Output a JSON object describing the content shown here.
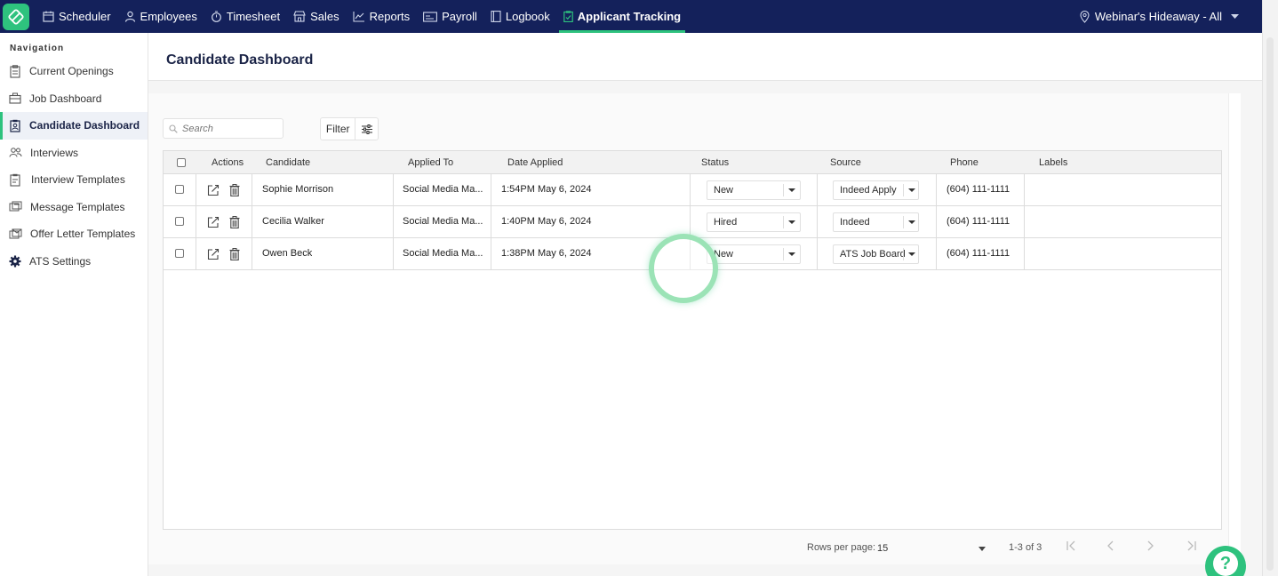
{
  "nav": {
    "items": [
      {
        "label": "Scheduler",
        "icon": "calendar-icon"
      },
      {
        "label": "Employees",
        "icon": "person-icon"
      },
      {
        "label": "Timesheet",
        "icon": "stopwatch-icon"
      },
      {
        "label": "Sales",
        "icon": "store-icon"
      },
      {
        "label": "Reports",
        "icon": "chart-line-icon"
      },
      {
        "label": "Payroll",
        "icon": "card-icon"
      },
      {
        "label": "Logbook",
        "icon": "book-icon"
      },
      {
        "label": "Applicant Tracking",
        "icon": "clipboard-icon"
      }
    ],
    "active": "Applicant Tracking",
    "location": "Webinar's Hideaway - All"
  },
  "sidebar": {
    "heading": "Navigation",
    "items": [
      {
        "label": "Current Openings",
        "icon": "clipboard-list-icon"
      },
      {
        "label": "Job Dashboard",
        "icon": "briefcase-icon"
      },
      {
        "label": "Candidate Dashboard",
        "icon": "id-badge-icon"
      },
      {
        "label": "Interviews",
        "icon": "people-icon"
      },
      {
        "label": "Interview Templates",
        "icon": "clipboard-template-icon"
      },
      {
        "label": "Message Templates",
        "icon": "message-icon"
      },
      {
        "label": "Offer Letter Templates",
        "icon": "letter-icon"
      },
      {
        "label": "ATS Settings",
        "icon": "gear-icon"
      }
    ],
    "active": "Candidate Dashboard"
  },
  "page": {
    "title": "Candidate Dashboard",
    "search_placeholder": "Search",
    "filter_label": "Filter"
  },
  "table": {
    "columns": [
      "Actions",
      "Candidate",
      "Applied To",
      "Date Applied",
      "Status",
      "Source",
      "Phone",
      "Labels"
    ],
    "rows": [
      {
        "candidate": "Sophie Morrison",
        "applied_to": "Social Media Ma...",
        "date": "1:54PM May 6, 2024",
        "status": "New",
        "source": "Indeed Apply",
        "phone": "(604) 111-1111",
        "labels": ""
      },
      {
        "candidate": "Cecilia Walker",
        "applied_to": "Social Media Ma...",
        "date": "1:40PM May 6, 2024",
        "status": "Hired",
        "source": "Indeed",
        "phone": "(604) 111-1111",
        "labels": ""
      },
      {
        "candidate": "Owen Beck",
        "applied_to": "Social Media Ma...",
        "date": "1:38PM May 6, 2024",
        "status": "New",
        "source": "ATS Job Board",
        "phone": "(604) 111-1111",
        "labels": ""
      }
    ]
  },
  "pagination": {
    "rows_per_page_label": "Rows per page:",
    "rows_per_page": "15",
    "range": "1-3 of 3"
  },
  "colors": {
    "nav_bg": "#14215b",
    "accent": "#2ec27e"
  }
}
